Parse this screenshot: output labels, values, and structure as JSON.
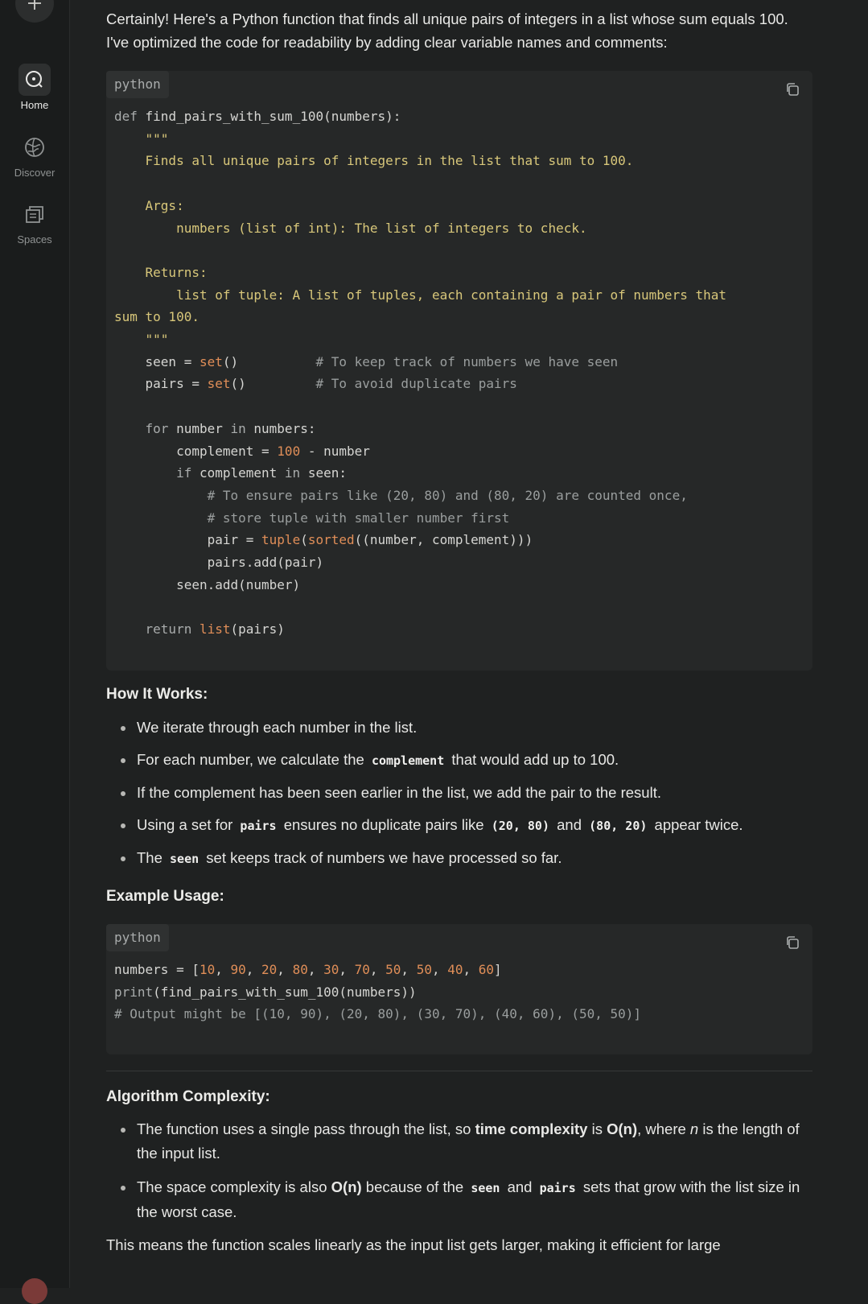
{
  "sidebar": {
    "items": [
      {
        "label": "Home",
        "icon": "home-compass-icon"
      },
      {
        "label": "Discover",
        "icon": "globe-icon"
      },
      {
        "label": "Spaces",
        "icon": "spaces-icon"
      }
    ]
  },
  "answer": {
    "intro": "Certainly! Here's a Python function that finds all unique pairs of integers in a list whose sum equals 100. I've optimized the code for readability by adding clear variable names and comments:",
    "code_blocks": [
      {
        "language": "python"
      },
      {
        "language": "python"
      }
    ],
    "how_it_works": {
      "heading": "How It Works:",
      "b1": "We iterate through each number in the list.",
      "b2_pre": "For each number, we calculate the",
      "b2_code": "complement",
      "b2_post": "that would add up to 100.",
      "b3": "If the complement has been seen earlier in the list, we add the pair to the result.",
      "b4_pre": "Using a set for",
      "b4_code1": "pairs",
      "b4_mid": "ensures no duplicate pairs like",
      "b4_code2": "(20, 80)",
      "b4_and": "and",
      "b4_code3": "(80, 20)",
      "b4_post": "appear twice.",
      "b5_pre": "The",
      "b5_code": "seen",
      "b5_post": "set keeps track of numbers we have processed so far."
    },
    "example_heading": "Example Usage:",
    "complexity": {
      "heading": "Algorithm Complexity:",
      "b1_pre": "The function uses a single pass through the list, so",
      "b1_bold": "time complexity",
      "b1_is": "is",
      "b1_o": "O(n)",
      "b1_where": ", where",
      "b1_n": "n",
      "b1_post": "is the length of the input list.",
      "b2_pre": "The space complexity is also",
      "b2_o": "O(n)",
      "b2_mid": "because of the",
      "b2_code1": "seen",
      "b2_and": "and",
      "b2_code2": "pairs",
      "b2_post": "sets that grow with the list size in the worst case."
    },
    "outro": "This means the function scales linearly as the input list gets larger, making it efficient for large"
  }
}
